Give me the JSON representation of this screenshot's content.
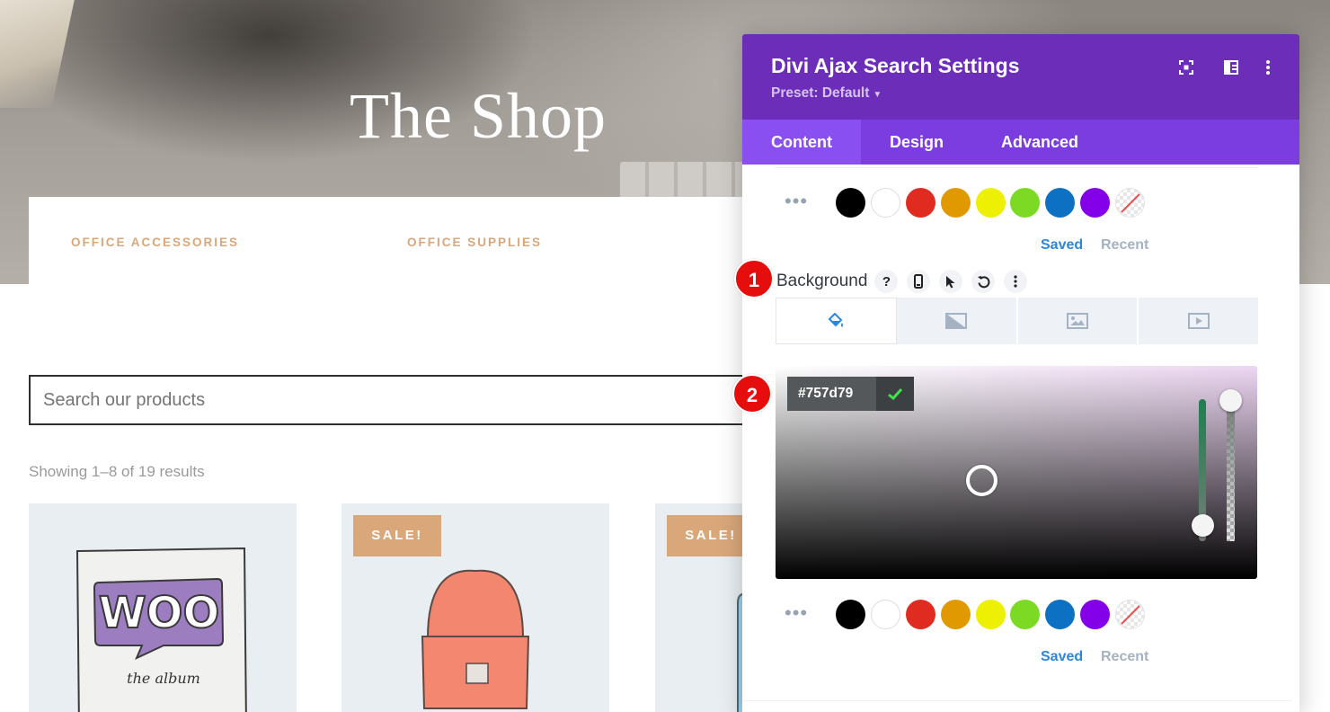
{
  "page": {
    "hero_title": "The Shop",
    "categories": [
      "OFFICE ACCESSORIES",
      "OFFICE SUPPLIES"
    ],
    "search_placeholder": "Search our products",
    "results_text": "Showing 1–8 of 19 results",
    "sale_badge": "SALE!",
    "product_art": {
      "woo_word": "WOO",
      "album_text": "the album"
    }
  },
  "modal": {
    "title": "Divi Ajax Search Settings",
    "preset": "Preset: Default",
    "header_icons": [
      "focus-mode-icon",
      "split-layout-icon",
      "more-options-icon"
    ],
    "tabs": [
      {
        "label": "Content",
        "active": true
      },
      {
        "label": "Design",
        "active": false
      },
      {
        "label": "Advanced",
        "active": false
      }
    ],
    "swatches": [
      "#000000",
      "#ffffff",
      "#e02b20",
      "#e09900",
      "#edf000",
      "#7cda24",
      "#0c71c3",
      "#8300e9",
      "none"
    ],
    "saved_label": "Saved",
    "recent_label": "Recent",
    "background_label": "Background",
    "background_field_icons": [
      "help-icon",
      "mobile-icon",
      "hover-cursor-icon",
      "reset-icon",
      "more-icon"
    ],
    "background_type_tabs": [
      "color-fill-icon",
      "gradient-icon",
      "image-icon",
      "video-icon"
    ],
    "color_value": "#757d79"
  },
  "markers": [
    "1",
    "2"
  ],
  "colors": {
    "modal_header": "#6c2eb9",
    "modal_tabs": "#7b3ce0",
    "active_tab": "#8a4ff0",
    "accent_link": "#2b87da",
    "category_text": "#d9a77a",
    "marker": "#e60d0d"
  }
}
